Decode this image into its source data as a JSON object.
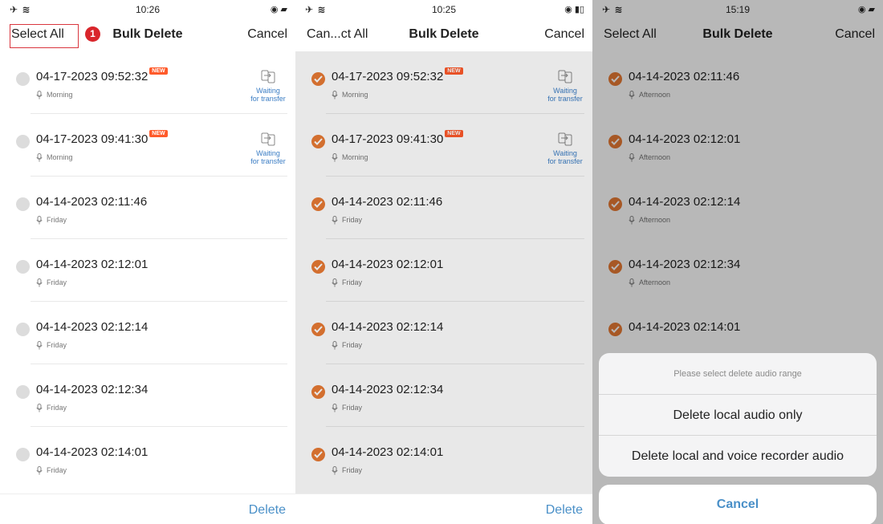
{
  "panels": [
    {
      "status": {
        "time": "10:26"
      },
      "nav": {
        "left": "Select All",
        "title": "Bulk Delete",
        "right": "Cancel"
      },
      "marker": "1",
      "footer": {
        "delete": "Delete"
      },
      "items": [
        {
          "datetime": "04-17-2023 09:52:32",
          "badge": "NEW",
          "label": "Morning",
          "status": "Waiting for transfer"
        },
        {
          "datetime": "04-17-2023 09:41:30",
          "badge": "NEW",
          "label": "Morning",
          "status": "Waiting for transfer"
        },
        {
          "datetime": "04-14-2023 02:11:46",
          "label": "Friday"
        },
        {
          "datetime": "04-14-2023 02:12:01",
          "label": "Friday"
        },
        {
          "datetime": "04-14-2023 02:12:14",
          "label": "Friday"
        },
        {
          "datetime": "04-14-2023 02:12:34",
          "label": "Friday"
        },
        {
          "datetime": "04-14-2023 02:14:01",
          "label": "Friday"
        }
      ]
    },
    {
      "status": {
        "time": "10:25"
      },
      "nav": {
        "left": "Can...ct All",
        "title": "Bulk Delete",
        "right": "Cancel"
      },
      "footer": {
        "delete": "Delete"
      },
      "items": [
        {
          "datetime": "04-17-2023 09:52:32",
          "badge": "NEW",
          "label": "Morning",
          "status": "Waiting for transfer"
        },
        {
          "datetime": "04-17-2023 09:41:30",
          "badge": "NEW",
          "label": "Morning",
          "status": "Waiting for transfer"
        },
        {
          "datetime": "04-14-2023 02:11:46",
          "label": "Friday"
        },
        {
          "datetime": "04-14-2023 02:12:01",
          "label": "Friday"
        },
        {
          "datetime": "04-14-2023 02:12:14",
          "label": "Friday"
        },
        {
          "datetime": "04-14-2023 02:12:34",
          "label": "Friday"
        },
        {
          "datetime": "04-14-2023 02:14:01",
          "label": "Friday"
        }
      ]
    },
    {
      "status": {
        "time": "15:19"
      },
      "nav": {
        "left": "Select All",
        "title": "Bulk Delete",
        "right": "Cancel"
      },
      "items": [
        {
          "datetime": "04-14-2023 02:11:46",
          "label": "Afternoon"
        },
        {
          "datetime": "04-14-2023 02:12:01",
          "label": "Afternoon"
        },
        {
          "datetime": "04-14-2023 02:12:14",
          "label": "Afternoon"
        },
        {
          "datetime": "04-14-2023 02:12:34",
          "label": "Afternoon"
        },
        {
          "datetime": "04-14-2023 02:14:01",
          "label": ""
        }
      ],
      "sheet": {
        "header": "Please select delete audio range",
        "option1": "Delete local audio only",
        "option2": "Delete local and voice recorder audio",
        "cancel": "Cancel"
      }
    }
  ],
  "colors": {
    "accent": "#4a90c8",
    "check": "#e87a34",
    "badge": "#ff5a2a",
    "marker": "#d9252b"
  },
  "icons": {
    "mic": "microphone-icon",
    "transfer": "transfer-phone-icon",
    "check": "checkmark-icon"
  }
}
